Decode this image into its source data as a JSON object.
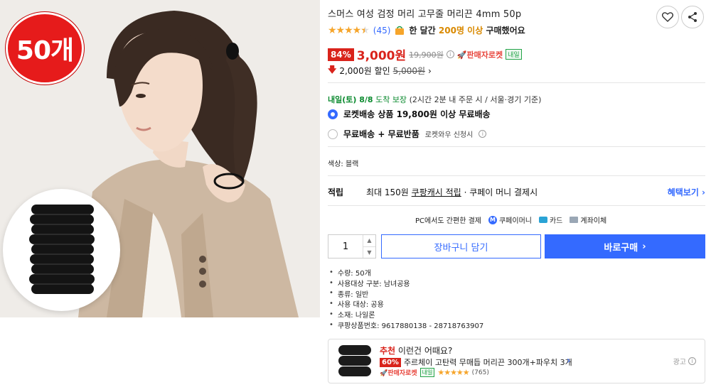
{
  "product": {
    "title": "스머스 여성 검정 머리 고무줄 머리끈 4mm 50p",
    "image_badge": "50개",
    "rating_stars": 4.5,
    "review_count": "(45)",
    "buy_note_prefix": "한 달간",
    "buy_note_highlight": "200명 이상",
    "buy_note_suffix": "구매했어요"
  },
  "price": {
    "discount_pct": "84%",
    "sale_price": "3,000원",
    "original_price": "19,900원",
    "seller_rocket": "🚀판매자로켓",
    "tomorrow_tag": "내일",
    "extra_discount": "2,000원 할인",
    "extra_discount_base": "5,000원"
  },
  "delivery": {
    "arrival_day": "내일(토) 8/8",
    "arrival_guarantee": "도착 보장",
    "arrival_note": "(2시간 2분 내 주문 시 / 서울·경기 기준)",
    "option1": "로켓배송 상품 19,800원 이상 무료배송",
    "option2_bold": "무료배송 + 무료반품",
    "option2_small": "로켓와우 신청시"
  },
  "color": "색상: 블랙",
  "points": {
    "label": "적립",
    "prefix": "최대 150원",
    "link": "쿠팡캐시 적립",
    "suffix": "· 쿠페이 머니 결제시",
    "benefit": "혜택보기 ›"
  },
  "payment": {
    "pc_note": "PC에서도 간편한 결제",
    "coupay": "쿠페이머니",
    "card": "카드",
    "bank": "계좌이체"
  },
  "purchase": {
    "quantity": "1",
    "cart_label": "장바구니 담기",
    "buy_label": "바로구매"
  },
  "specs": [
    "수량: 50개",
    "사용대상 구분: 남녀공용",
    "종류: 일반",
    "사용 대상: 공용",
    "소재: 나일론",
    "쿠팡상품번호: 9617880138 - 28718763907"
  ],
  "recommendation": {
    "head_red": "추천",
    "head_rest": "이런건 어때요?",
    "discount": "60%",
    "title": "주르체이 고탄력 무매듭 머리끈 300개+파우치 3개",
    "seller": "🚀판매자로켓",
    "tomorrow": "내일",
    "stars": 5,
    "count": "(765)",
    "ad_label": "광고"
  },
  "colors": {
    "accent": "#346aff",
    "sale_red": "#d9231b",
    "star": "#f6a52b",
    "green": "#0a8a2e"
  }
}
